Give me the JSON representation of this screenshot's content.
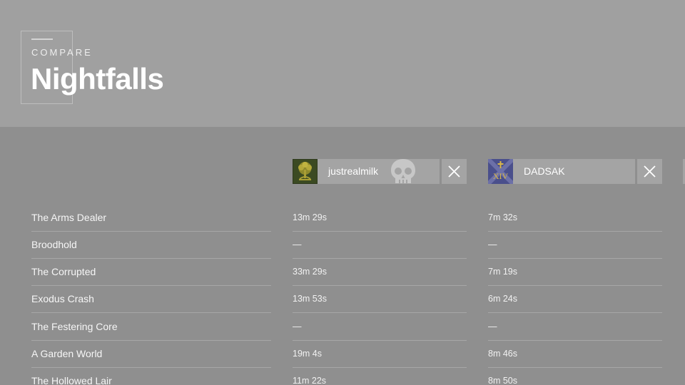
{
  "header": {
    "eyebrow": "COMPARE",
    "title": "Nightfalls"
  },
  "players": [
    {
      "name": "justrealmilk",
      "emblem": "tree-emblem-icon",
      "remove_icon": "close-icon"
    },
    {
      "name": "DADSAK",
      "emblem": "xiv-emblem-icon",
      "remove_icon": "close-icon"
    }
  ],
  "rows": [
    {
      "name": "The Arms Dealer",
      "values": [
        "13m 29s",
        "7m 32s"
      ]
    },
    {
      "name": "Broodhold",
      "values": [
        "—",
        "—"
      ]
    },
    {
      "name": "The Corrupted",
      "values": [
        "33m 29s",
        "7m 19s"
      ]
    },
    {
      "name": "Exodus Crash",
      "values": [
        "13m 53s",
        "6m 24s"
      ]
    },
    {
      "name": "The Festering Core",
      "values": [
        "—",
        "—"
      ]
    },
    {
      "name": "A Garden World",
      "values": [
        "19m 4s",
        "8m 46s"
      ]
    },
    {
      "name": "The Hollowed Lair",
      "values": [
        "11m 22s",
        "8m 50s"
      ]
    }
  ],
  "colors": {
    "background": "#8f8f8f",
    "header_background": "#a0a0a0",
    "card_background": "#a4a4a4"
  }
}
